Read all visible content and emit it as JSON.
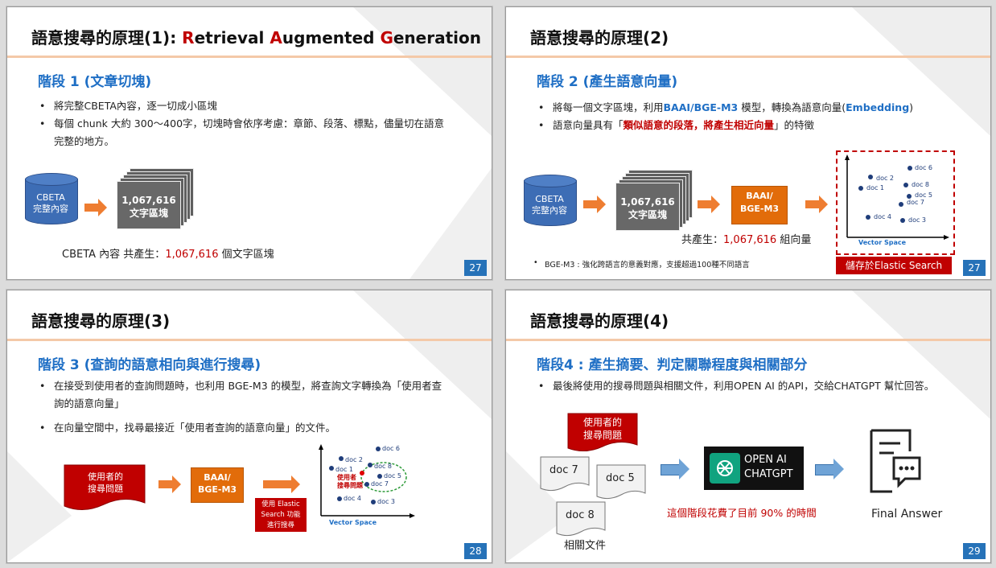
{
  "slide27": {
    "title_prefix": "語意搜尋的原理(1): ",
    "title_r": "R",
    "title_etrieval": "etrieval ",
    "title_a": "A",
    "title_ugmented": "ugmented ",
    "title_g": "G",
    "title_eneration": "eneration",
    "stage": "階段 1 (文章切塊)",
    "bullet1": "將完整CBETA內容，逐一切成小區塊",
    "bullet2": "每個 chunk 大約 300～400字，切塊時會依序考慮：章節、段落、標點，儘量切在語意完整的地方。",
    "cyl_label": "CBETA\n完整內容",
    "stack_num": "1,067,616",
    "stack_label": "文字區塊",
    "summary_prefix": "CBETA 內容 共產生：",
    "summary_num": "1,067,616",
    "summary_suffix": " 個文字區塊",
    "page": "27"
  },
  "slide27b": {
    "title": "語意搜尋的原理(2)",
    "stage": "階段 2 (產生語意向量)",
    "b1_a": "將每一個文字區塊，利用",
    "b1_b": "BAAI/BGE-M3",
    "b1_c": " 模型，轉換為語意向量(",
    "b1_d": "Embedding",
    "b1_e": ")",
    "b2_a": "語意向量具有「",
    "b2_b": "類似語意的段落，將產生相近向量",
    "b2_c": "」的特徵",
    "cyl_label": "CBETA\n完整內容",
    "stack_num": "1,067,616",
    "stack_label": "文字區塊",
    "model": "BAAI/\nBGE-M3",
    "summary_prefix": "共產生：",
    "summary_num": "1,067,616",
    "summary_suffix": " 組向量",
    "note": "BGE-M3 : 強化跨語言的意義對應，支援超過100種不同語言",
    "vector_space": "Vector Space",
    "docs": [
      "doc 6",
      "doc 2",
      "doc 1",
      "doc 8",
      "doc 5",
      "doc 7",
      "doc 4",
      "doc 3"
    ],
    "store": "儲存於Elastic Search",
    "page": "27"
  },
  "slide28": {
    "title": "語意搜尋的原理(3)",
    "stage": "階段 3 (查詢的語意相向與進行搜尋)",
    "bullet1": "在接受到使用者的查詢問題時，也利用 BGE-M3 的模型，將查詢文字轉換為「使用者查詢的語意向量」",
    "bullet2": "在向量空間中，找尋最接近「使用者查詢的語意向量」的文件。",
    "query": "使用者的\n搜尋問題",
    "model": "BAAI/\nBGE-M3",
    "search": "使用 Elastic\nSearch 功能\n進行搜尋",
    "vector_space": "Vector Space",
    "docs": [
      "doc 6",
      "doc 2",
      "doc 1",
      "doc 8",
      "doc 5",
      "doc 7",
      "doc 4",
      "doc 3"
    ],
    "query_point": "使用者\n搜尋問題",
    "page": "28"
  },
  "slide29": {
    "title": "語意搜尋的原理(4)",
    "stage": "階段4 : 產生摘要、判定關聯程度與相關部分",
    "bullet1": "最後將使用的搜尋問題與相關文件，利用OPEN AI 的API，交給CHATGPT 幫忙回答。",
    "query": "使用者的\n搜尋問題",
    "docs": [
      "doc 7",
      "doc 5",
      "doc 8"
    ],
    "related": "相關文件",
    "openai": "OPEN AI\nCHATGPT",
    "time_note": "這個階段花費了目前 90% 的時間",
    "final": "Final Answer",
    "page": "29"
  },
  "colors": {
    "blue": "#1f6fc5",
    "red": "#c00000",
    "orange": "#e26c0a",
    "accent": "#2672b8"
  }
}
